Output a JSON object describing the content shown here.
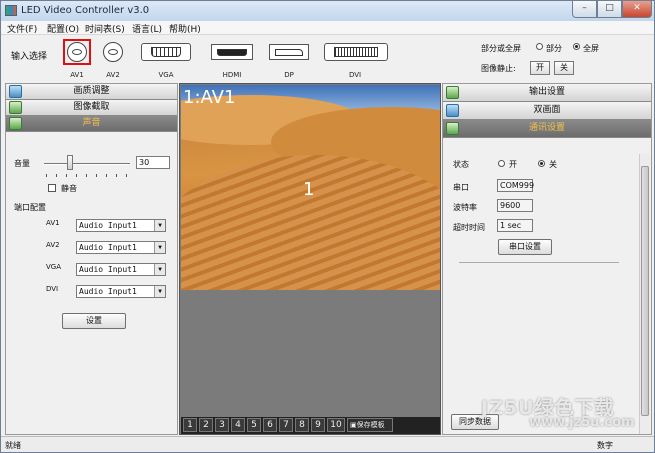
{
  "window": {
    "title": "LED Video Controller v3.0",
    "min": "–",
    "max": "□",
    "close": "✕"
  },
  "menu": [
    "文件(F)",
    "配置(O)",
    "时间表(S)",
    "语言(L)",
    "帮助(H)"
  ],
  "input": {
    "label": "输入选择",
    "sources": [
      {
        "label": "AV1",
        "icon": "av-connector-icon",
        "selected": true
      },
      {
        "label": "AV2",
        "icon": "av-connector-icon",
        "selected": false
      },
      {
        "label": "VGA",
        "icon": "vga-connector-icon",
        "selected": false
      },
      {
        "label": "HDMI",
        "icon": "hdmi-connector-icon",
        "selected": false
      },
      {
        "label": "DP",
        "icon": "displayport-connector-icon",
        "selected": false
      },
      {
        "label": "DVI",
        "icon": "dvi-connector-icon",
        "selected": false
      }
    ]
  },
  "screen_mode": {
    "label": "部分或全屏",
    "option_partial": "部分",
    "option_full": "全屏",
    "selected": "全屏",
    "freeze_label": "图像静止:",
    "on_btn": "开",
    "off_btn": "关"
  },
  "left": {
    "headers": [
      "画质调整",
      "图像截取",
      "声音"
    ],
    "active": "声音",
    "volume_label": "音量",
    "volume_value": "30",
    "volume_level": 0.3,
    "mute_label": "静音",
    "port_config_label": "端口配置",
    "ports": [
      {
        "name": "AV1",
        "value": "Audio Input1"
      },
      {
        "name": "AV2",
        "value": "Audio Input1"
      },
      {
        "name": "VGA",
        "value": "Audio Input1"
      },
      {
        "name": "DVI",
        "value": "Audio Input1"
      }
    ],
    "set_button": "设置"
  },
  "preview": {
    "window_label": "1:AV1",
    "window_number": "1",
    "tabs": [
      "1",
      "2",
      "3",
      "4",
      "5",
      "6",
      "7",
      "8",
      "9",
      "10"
    ],
    "save_template": "保存模板"
  },
  "right": {
    "headers": [
      "输出设置",
      "双画面",
      "通讯设置"
    ],
    "active": "通讯设置",
    "status_label": "状态",
    "status_on": "开",
    "status_off": "关",
    "status_selected": "关",
    "port_label": "串口",
    "port_value": "COM999",
    "baud_label": "波特率",
    "baud_value": "9600",
    "timeout_label": "超时时间",
    "timeout_value": "1 sec",
    "serial_button": "串口设置",
    "sync_button": "同步数据"
  },
  "status": {
    "left": "就绪",
    "right": "数字"
  },
  "watermark": {
    "main": "JZ5U绿色下载",
    "sub": "www.jz5u.com"
  }
}
